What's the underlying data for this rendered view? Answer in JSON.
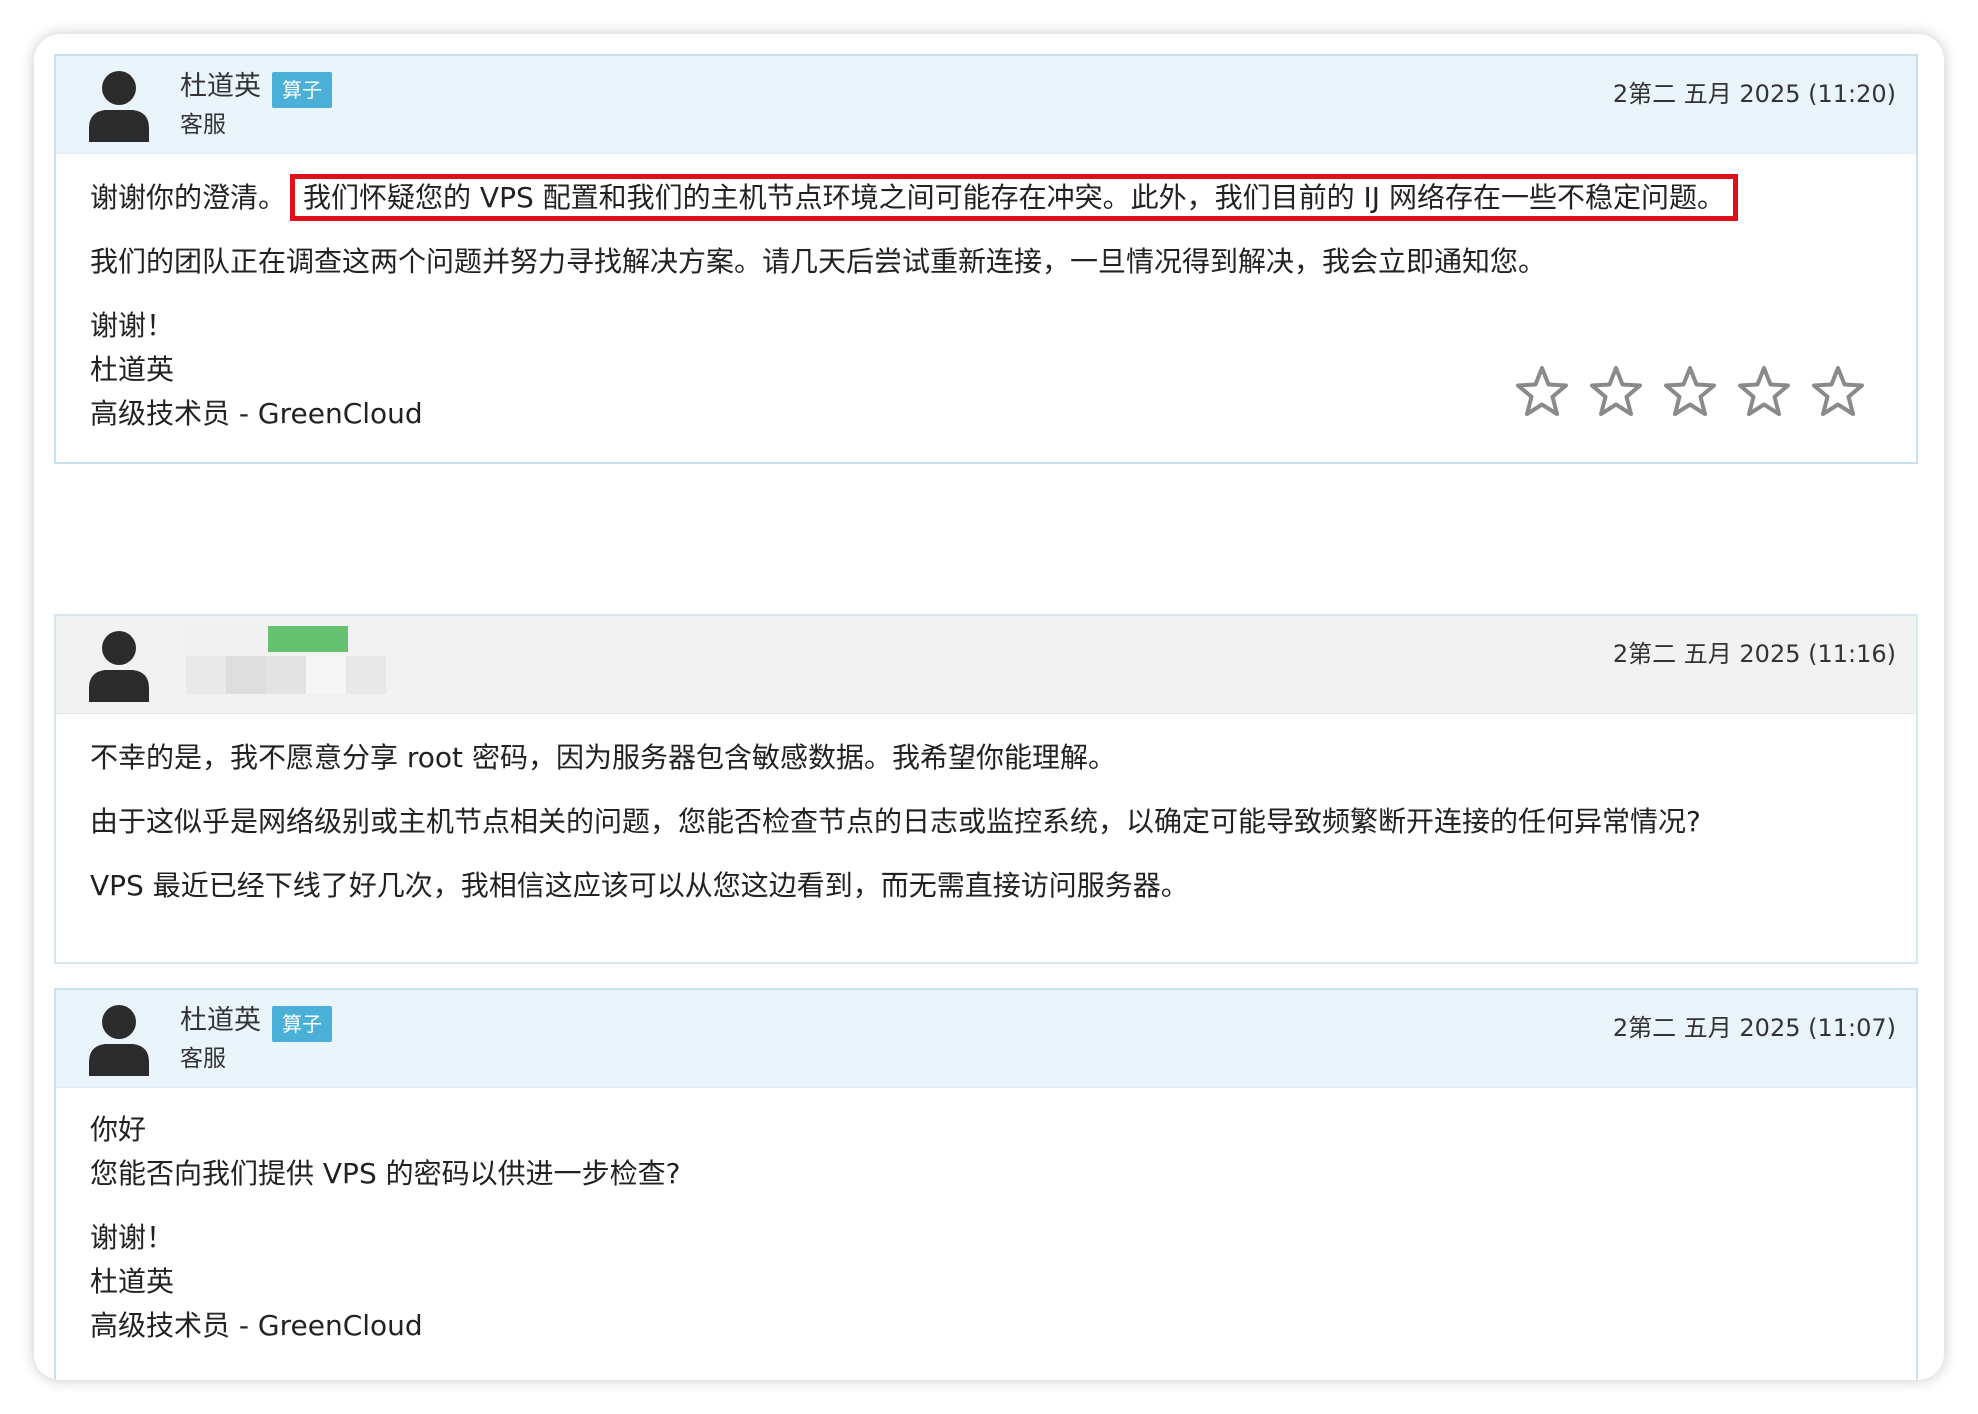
{
  "messages": [
    {
      "author": "杜道英",
      "badge": "算子",
      "role": "客服",
      "timestamp": "2第二 五月 2025 (11:20)",
      "body": {
        "intro": "谢谢你的澄清。",
        "highlighted": "我们怀疑您的 VPS 配置和我们的主机节点环境之间可能存在冲突。此外，我们目前的 IJ 网络存在一些不稳定问题。",
        "p2": "我们的团队正在调查这两个问题并努力寻找解决方案。请几天后尝试重新连接，一旦情况得到解决，我会立即通知您。",
        "sig1": "谢谢！",
        "sig2": "杜道英",
        "sig3": "高级技术员 - GreenCloud"
      },
      "rating_icons": [
        "star-outline",
        "star-outline",
        "star-outline",
        "star-outline",
        "star-outline"
      ]
    },
    {
      "timestamp": "2第二 五月 2025 (11:16)",
      "body": {
        "p1": "不幸的是，我不愿意分享 root 密码，因为服务器包含敏感数据。我希望你能理解。",
        "p2": "由于这似乎是网络级别或主机节点相关的问题，您能否检查节点的日志或监控系统，以确定可能导致频繁断开连接的任何异常情况?",
        "p3": "VPS 最近已经下线了好几次，我相信这应该可以从您这边看到，而无需直接访问服务器。"
      }
    },
    {
      "author": "杜道英",
      "badge": "算子",
      "role": "客服",
      "timestamp": "2第二 五月 2025 (11:07)",
      "body": {
        "l1": "你好",
        "l2": "您能否向我们提供 VPS 的密码以供进一步检查?",
        "sig1": "谢谢！",
        "sig2": "杜道英",
        "sig3": "高级技术员 - GreenCloud"
      }
    }
  ],
  "colors": {
    "badge": "#4bb0d8",
    "highlight_border": "#e0101a",
    "staff_header": "#eaf4fb",
    "client_header": "#f2f2f2"
  }
}
